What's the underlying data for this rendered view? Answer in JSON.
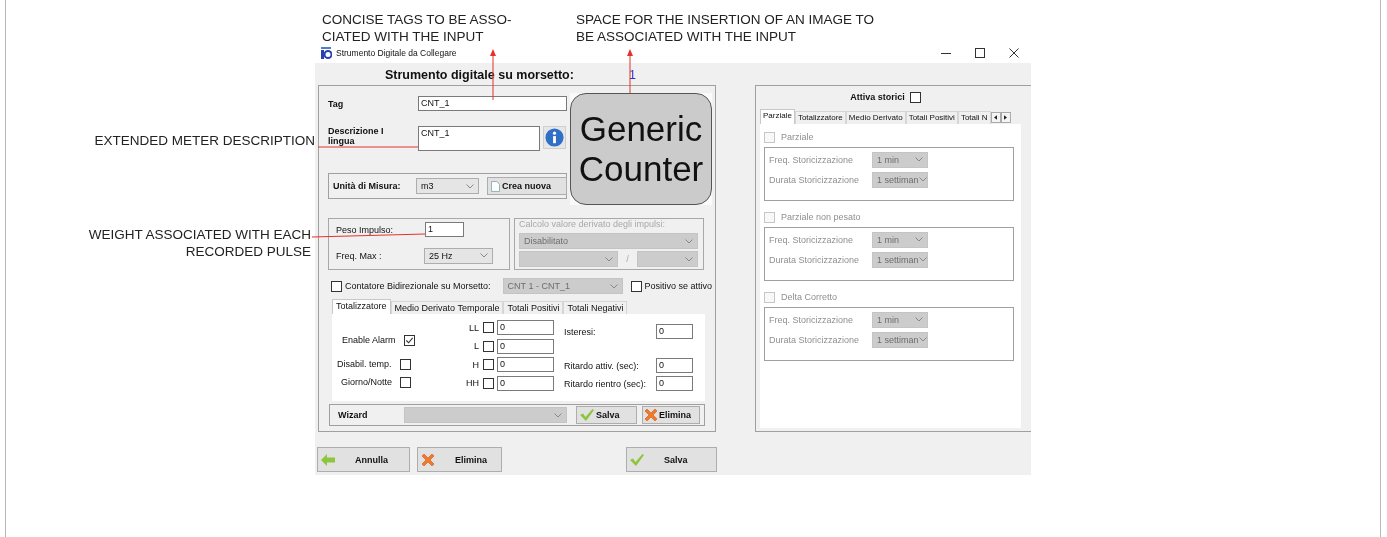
{
  "annotations": [
    {
      "lines": [
        "CONCISE TAGS TO BE ASSO-",
        "CIATED WITH THE INPUT"
      ]
    },
    {
      "lines": [
        "SPACE FOR THE INSERTION OF AN IMAGE TO",
        "BE ASSOCIATED WITH THE INPUT"
      ]
    },
    {
      "lines": [
        "EXTENDED METER DESCRIPTION"
      ]
    },
    {
      "lines": [
        "WEIGHT ASSOCIATED WITH EACH",
        "RECORDED PULSE"
      ]
    }
  ],
  "window": {
    "title": "Strumento Digitale da Collegare"
  },
  "header": {
    "label": "Strumento digitale su morsetto:",
    "value": "1"
  },
  "tag": {
    "label": "Tag",
    "value": "CNT_1"
  },
  "description": {
    "label": "Descrizione I lingua",
    "value": "CNT_1"
  },
  "image": {
    "text": "Generic Counter"
  },
  "unit": {
    "label": "Unità di Misura:",
    "value": "m3",
    "button": "Crea nuova"
  },
  "pulse": {
    "weight_label": "Peso Impulso:",
    "weight": "1",
    "freq_label": "Freq. Max :",
    "freq": "25 Hz"
  },
  "derived": {
    "disabled": true,
    "legend": "Calcolo valore derivato degli impulsi:",
    "mode": "Disabilitato",
    "separator": "/"
  },
  "bidirectional": {
    "label": "Contatore Bidirezionale su Morsetto:",
    "checked": false,
    "counter": "CNT 1 - CNT_1",
    "counter_disabled": true,
    "positive_label": "Positivo se attivo",
    "positive_checked": false
  },
  "alarm_tabs": [
    {
      "label": "Totalizzatore",
      "selected": true
    },
    {
      "label": "Medio Derivato Temporale",
      "selected": false
    },
    {
      "label": "Totali Positivi",
      "selected": false
    },
    {
      "label": "Totali Negativi",
      "selected": false
    }
  ],
  "alarm": {
    "options": [
      {
        "label": "Enable Alarm",
        "checked": true
      },
      {
        "label": "Disabil. temp.",
        "checked": false
      },
      {
        "label": "Giorno/Notte",
        "checked": false
      }
    ],
    "thresholds": [
      {
        "label": "LL",
        "checked": false,
        "value": "0"
      },
      {
        "label": "L",
        "checked": false,
        "value": "0"
      },
      {
        "label": "H",
        "checked": false,
        "value": "0"
      },
      {
        "label": "HH",
        "checked": false,
        "value": "0"
      }
    ],
    "settings": [
      {
        "label": "Isteresi:",
        "value": "0"
      },
      {
        "label": "Ritardo attiv. (sec):",
        "value": "0"
      },
      {
        "label": "Ritardo rientro (sec):",
        "value": "0"
      }
    ]
  },
  "wizard": {
    "label": "Wizard",
    "disabled": true,
    "save": "Salva",
    "delete": "Elimina"
  },
  "buttons": [
    {
      "kind": "cancel",
      "label": "Annulla"
    },
    {
      "kind": "delete",
      "label": "Elimina"
    },
    {
      "kind": "save",
      "label": "Salva"
    }
  ],
  "history": {
    "label": "Attiva storici",
    "checked": false,
    "tabs": [
      {
        "label": "Parziale",
        "selected": true
      },
      {
        "label": "Totalizzatore",
        "selected": false
      },
      {
        "label": "Medio Derivato",
        "selected": false
      },
      {
        "label": "Totali Positivi",
        "selected": false
      },
      {
        "label": "Totali N",
        "selected": false
      }
    ],
    "sections": [
      {
        "label": "Parziale",
        "checked": false,
        "disabled": true,
        "rows": [
          {
            "label": "Freq. Storicizzazione",
            "value": "1 min"
          },
          {
            "label": "Durata Storicizzazione",
            "value": "1 settiman"
          }
        ]
      },
      {
        "label": "Parziale non pesato",
        "checked": false,
        "disabled": true,
        "rows": [
          {
            "label": "Freq. Storicizzazione",
            "value": "1 min"
          },
          {
            "label": "Durata Storicizzazione",
            "value": "1 settiman"
          }
        ]
      },
      {
        "label": "Delta Corretto",
        "checked": false,
        "disabled": true,
        "rows": [
          {
            "label": "Freq. Storicizzazione",
            "value": "1 min"
          },
          {
            "label": "Durata Storicizzazione",
            "value": "1 settiman"
          }
        ]
      }
    ]
  }
}
